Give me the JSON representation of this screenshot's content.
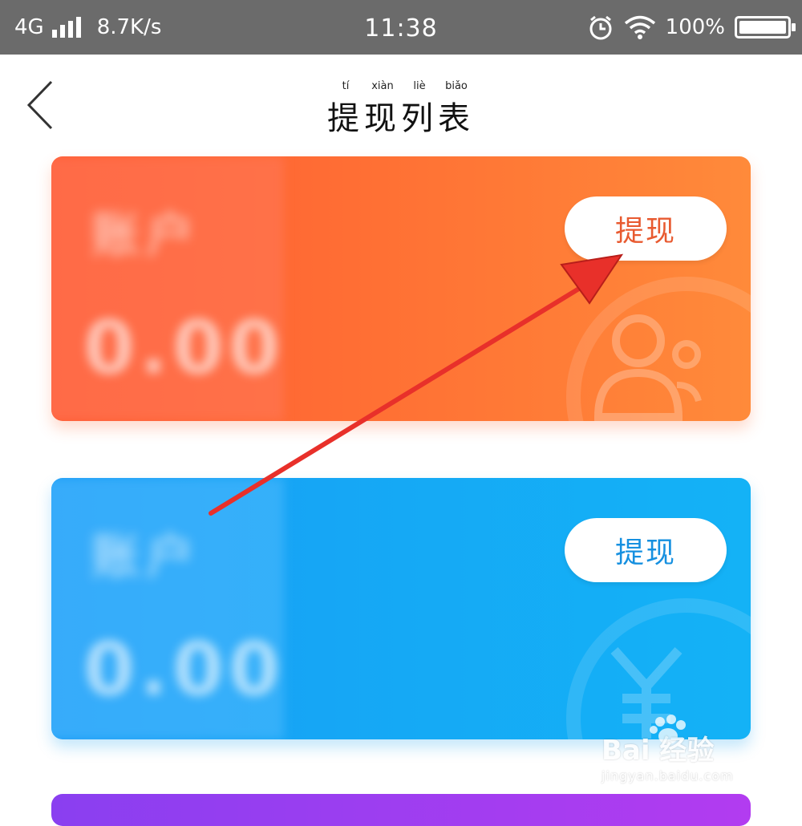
{
  "status_bar": {
    "network": "4G",
    "speed": "8.7K/s",
    "time": "11:38",
    "battery": "100%"
  },
  "header": {
    "title": "提现列表",
    "pinyin": [
      "tí",
      "xiàn",
      "liè",
      "biǎo"
    ],
    "back_icon": "chevron-left-icon"
  },
  "cards": [
    {
      "color": "#ff6a34",
      "label_blurred": "账户",
      "amount": "0.00",
      "button_label": "提现",
      "button_text_color": "#e85a30",
      "decoration_icon": "user-badge-icon"
    },
    {
      "color": "#18a6f5",
      "label_blurred": "账户",
      "amount": "0.00",
      "button_label": "提现",
      "button_text_color": "#1690e0",
      "decoration_icon": "yuan-icon"
    }
  ],
  "annotation": {
    "arrow_color": "#e8302a"
  },
  "watermark": {
    "brand": "Bai 经验",
    "url": "jingyan.baidu.com"
  }
}
